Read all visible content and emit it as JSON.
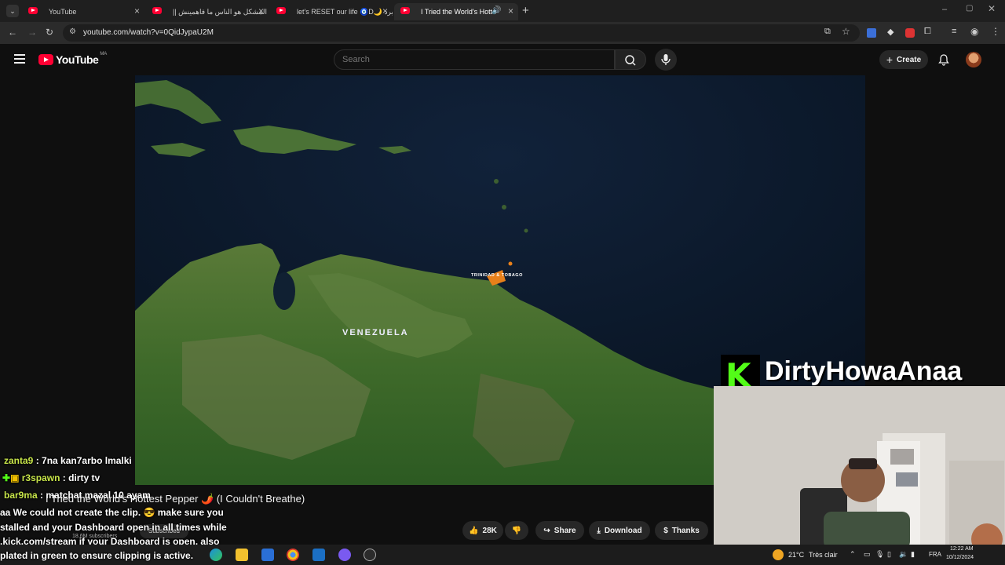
{
  "browser": {
    "tabs": [
      {
        "title": "YouTube"
      },
      {
        "title": "المشكل هو الناس ما فاهمينش ||"
      },
      {
        "title": "let's RESET our life 🧿D🌙 البرد"
      },
      {
        "title": "I Tried the World's Hottest P"
      }
    ],
    "url": "youtube.com/watch?v=0QidJypaU2M"
  },
  "youtube": {
    "logo_text": "YouTube",
    "country_code": "MA",
    "search_placeholder": "Search",
    "create_label": "Create"
  },
  "video": {
    "map_labels": {
      "country": "VENEZUELA",
      "island": "TRINIDAD & TOBAGO"
    },
    "title": "I Tried the World's Hottest Pepper 🌶️ (I Couldn't Breathe)",
    "subscribers": "18.6M subscribers",
    "subscribed_label": "Subscribed",
    "like_count": "28K",
    "share_label": "Share",
    "download_label": "Download",
    "thanks_label": "Thanks"
  },
  "stream_overlay": {
    "brand_letter": "K",
    "channel_name": "DirtyHowaAnaa",
    "chat": [
      {
        "user": "zanta9",
        "message": "7na kan7arbo lmalki"
      },
      {
        "user": "r3spawn",
        "message": "dirty tv"
      },
      {
        "user": "bar9ma",
        "message": "matchat mazal 10 ayam"
      }
    ],
    "system_message": [
      "aa We could not create the clip. 😎 make sure you",
      "stalled and your Dashboard open in all times while",
      ".kick.com/stream if your Dashboard is open, also",
      "plated in green to ensure clipping is active."
    ]
  },
  "taskbar": {
    "weather": "21°C",
    "weather_desc": "Très clair",
    "language": "FRA",
    "time": "12:22 AM",
    "date": "10/12/2024"
  },
  "colors": {
    "youtube_red": "#ff0033",
    "kick_green": "#53fc18",
    "chat_user": "#c8e64a"
  }
}
